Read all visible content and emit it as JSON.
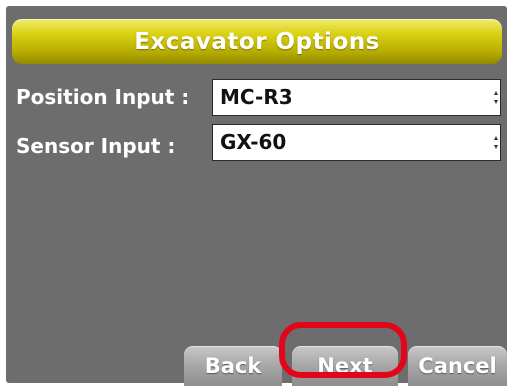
{
  "header": {
    "title": "Excavator Options"
  },
  "fields": [
    {
      "label": "Position Input :",
      "value": "MC-R3"
    },
    {
      "label": "Sensor Input :",
      "value": "GX-60"
    }
  ],
  "buttons": {
    "back": "Back",
    "next": "Next",
    "cancel": "Cancel"
  },
  "colors": {
    "title_bar": "#d8cf12",
    "screen_background": "#6d6d6d",
    "button": "#a9a9a9",
    "highlight": "#e3061b"
  }
}
